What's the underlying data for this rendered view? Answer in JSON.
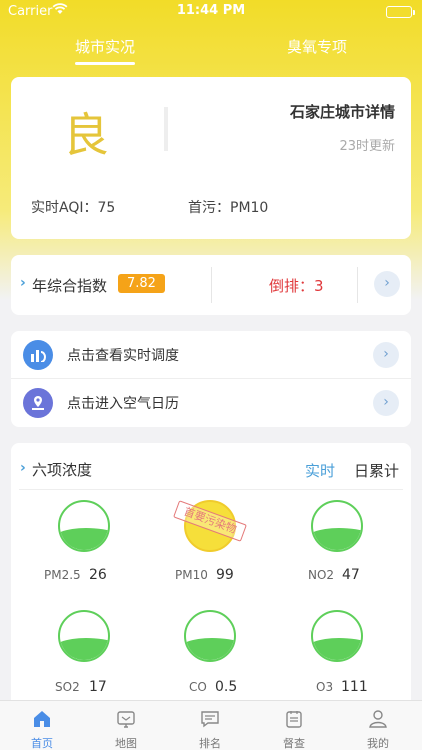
{
  "status_bar": {
    "carrier": "Carrier",
    "time": "11:44 PM"
  },
  "top_tabs": [
    {
      "label": "城市实况",
      "active": true
    },
    {
      "label": "臭氧专项",
      "active": false
    }
  ],
  "city_card": {
    "grade": "良",
    "title": "石家庄城市详情",
    "update": "23时更新",
    "aqi": "实时AQI：75",
    "primary_pollutant": "首污：PM10"
  },
  "index_card": {
    "label": "年综合指数",
    "value": "7.82",
    "rank": "倒排：3"
  },
  "links": [
    {
      "label": "点击查看实时调度",
      "icon": "realtime-dispatch-icon"
    },
    {
      "label": "点击进入空气日历",
      "icon": "air-calendar-icon"
    }
  ],
  "concentration": {
    "title": "六项浓度",
    "tabs": [
      {
        "label": "实时",
        "active": true
      },
      {
        "label": "日累计",
        "active": false
      }
    ],
    "stamp": "首要污染物",
    "items": [
      {
        "name": "PM2.5",
        "value": "26",
        "color": "#5ecf5a"
      },
      {
        "name": "PM10",
        "value": "99",
        "color": "#f0cc2c"
      },
      {
        "name": "NO2",
        "value": "47",
        "color": "#5ecf5a"
      },
      {
        "name": "SO2",
        "value": "17",
        "color": "#5ecf5a"
      },
      {
        "name": "CO",
        "value": "0.5",
        "color": "#5ecf5a"
      },
      {
        "name": "O3",
        "value": "111",
        "color": "#5ecf5a"
      }
    ]
  },
  "bottom_nav": [
    {
      "label": "首页",
      "icon": "home-icon",
      "active": true
    },
    {
      "label": "地图",
      "icon": "map-icon",
      "active": false
    },
    {
      "label": "排名",
      "icon": "ranking-icon",
      "active": false
    },
    {
      "label": "督查",
      "icon": "inspection-icon",
      "active": false
    },
    {
      "label": "我的",
      "icon": "profile-icon",
      "active": false
    }
  ],
  "colors": {
    "accent": "#4a9fd8",
    "yellow": "#f2dc28",
    "good": "#e5c53a",
    "badge": "#f5a318",
    "rank": "#e0383b"
  }
}
